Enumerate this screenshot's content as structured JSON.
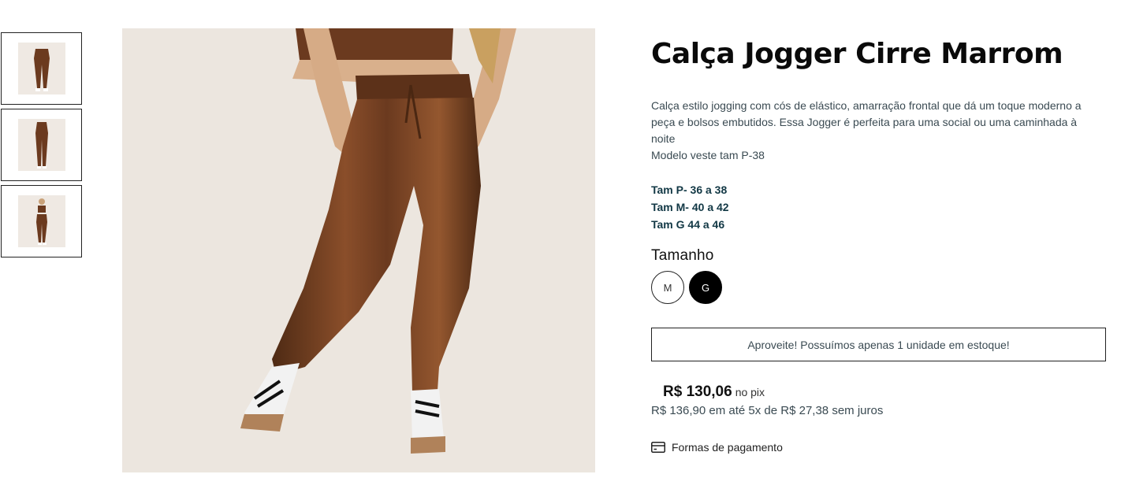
{
  "thumbnails": [
    {
      "label": "front-full"
    },
    {
      "label": "back"
    },
    {
      "label": "full-body"
    }
  ],
  "product": {
    "title": "Calça Jogger Cirre Marrom",
    "description_lines": [
      "Calça estilo jogging com cós de elástico, amarração frontal que dá um toque moderno a peça e bolsos embutidos. Essa Jogger é perfeita para uma social ou uma caminhada à noite",
      "Modelo veste tam P-38"
    ],
    "size_table": [
      "Tam P- 36 a 38",
      "Tam M- 40 a 42",
      "Tam G 44 a 46"
    ],
    "size_label": "Tamanho",
    "sizes": [
      "M",
      "G"
    ],
    "selected_size": "G",
    "stock_message": "Aproveite! Possuímos apenas 1 unidade em estoque!",
    "price": "R$ 130,06",
    "price_suffix": "no pix",
    "installments": "R$ 136,90 em até 5x de R$ 27,38 sem juros",
    "payment_label": "Formas de pagamento"
  },
  "colors": {
    "pants": "#6b3a1f",
    "background_photo": "#ece6df",
    "text_dark": "#3a4a52"
  }
}
